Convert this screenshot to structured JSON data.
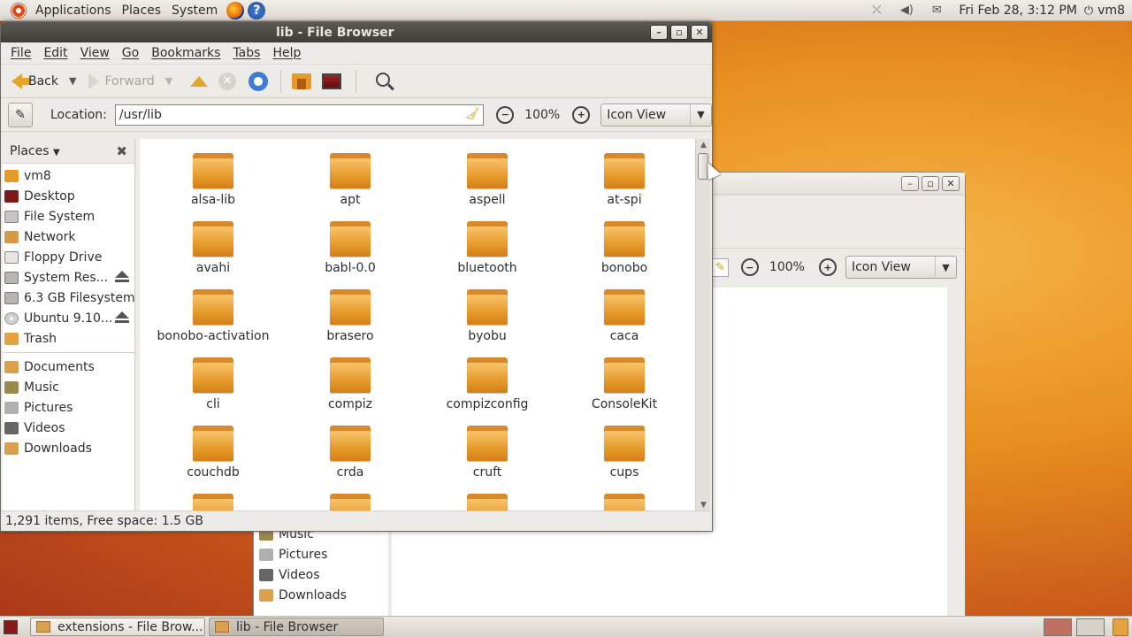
{
  "top_panel": {
    "menus": [
      "Applications",
      "Places",
      "System"
    ],
    "clock": "Fri Feb 28,  3:12 PM",
    "user": "vm8",
    "help_glyph": "?"
  },
  "bg_window": {
    "zoom": "100%",
    "view_mode": "Icon View",
    "sidebar_items": [
      "Music",
      "Pictures",
      "Videos",
      "Downloads"
    ]
  },
  "main_window": {
    "title": "lib - File Browser",
    "menu": [
      "File",
      "Edit",
      "View",
      "Go",
      "Bookmarks",
      "Tabs",
      "Help"
    ],
    "toolbar": {
      "back": "Back",
      "forward": "Forward"
    },
    "location": {
      "label": "Location:",
      "value": "/usr/lib"
    },
    "zoom": "100%",
    "view_mode": "Icon View",
    "sidebar": {
      "header": "Places",
      "items": [
        {
          "label": "vm8",
          "icon": "home-folder-icon"
        },
        {
          "label": "Desktop",
          "icon": "desktop-icon"
        },
        {
          "label": "File System",
          "icon": "filesystem-icon"
        },
        {
          "label": "Network",
          "icon": "network-icon"
        },
        {
          "label": "Floppy Drive",
          "icon": "floppy-icon"
        },
        {
          "label": "System Res...",
          "icon": "drive-icon",
          "eject": true
        },
        {
          "label": "6.3 GB Filesystem",
          "icon": "drive-icon"
        },
        {
          "label": "Ubuntu 9.10...",
          "icon": "cdrom-icon",
          "eject": true
        },
        {
          "label": "Trash",
          "icon": "trash-icon"
        }
      ],
      "bookmarks": [
        {
          "label": "Documents",
          "icon": "folder-icon"
        },
        {
          "label": "Music",
          "icon": "music-folder-icon"
        },
        {
          "label": "Pictures",
          "icon": "pictures-folder-icon"
        },
        {
          "label": "Videos",
          "icon": "videos-folder-icon"
        },
        {
          "label": "Downloads",
          "icon": "folder-icon"
        }
      ]
    },
    "files": [
      "alsa-lib",
      "apt",
      "aspell",
      "at-spi",
      "avahi",
      "babl-0.0",
      "bluetooth",
      "bonobo",
      "bonobo-activation",
      "brasero",
      "byobu",
      "caca",
      "cli",
      "compiz",
      "compizconfig",
      "ConsoleKit",
      "couchdb",
      "crda",
      "cruft",
      "cups",
      "",
      "",
      "",
      ""
    ],
    "status": "1,291 items, Free space: 1.5 GB"
  },
  "taskbar": {
    "tasks": [
      "extensions - File Brow...",
      "lib - File Browser"
    ]
  }
}
